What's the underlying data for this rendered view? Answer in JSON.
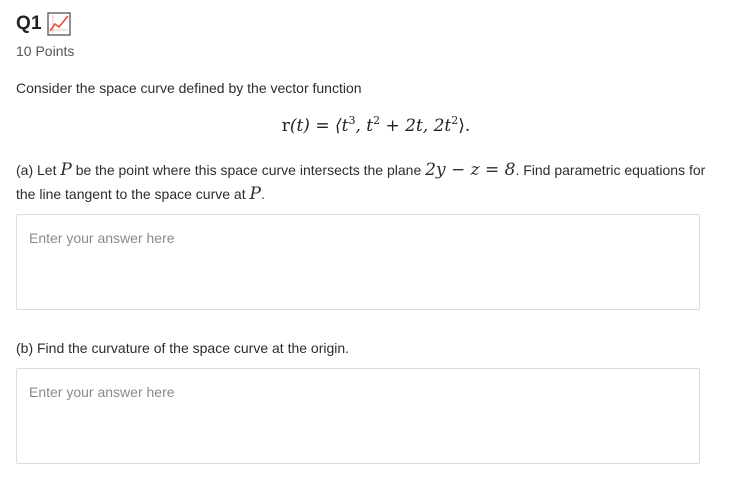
{
  "question": {
    "title": "Q1",
    "points": "10 Points",
    "icon": "graded-chart-icon"
  },
  "intro": "Consider the space curve defined by the vector function",
  "equation": {
    "lhs": "r",
    "arg": "(t) = ⟨t",
    "p1": "3",
    "mid1": ", t",
    "p2": "2",
    "mid2": " + 2t, 2t",
    "p3": "2",
    "end": "⟩."
  },
  "part_a": {
    "prefix": "(a) Let ",
    "P": "P",
    "middle": " be the point where this space curve intersects the plane ",
    "plane": "2y − z = 8",
    "after_plane": ". Find parametric equations for the line tangent to the space curve at ",
    "P2": "P",
    "end": "."
  },
  "part_b": {
    "text": "(b) Find the curvature of the space curve at the origin."
  },
  "answer": {
    "placeholder": "Enter your answer here"
  },
  "colors": {
    "icon_border": "#555555",
    "icon_line": "#e8503a"
  }
}
